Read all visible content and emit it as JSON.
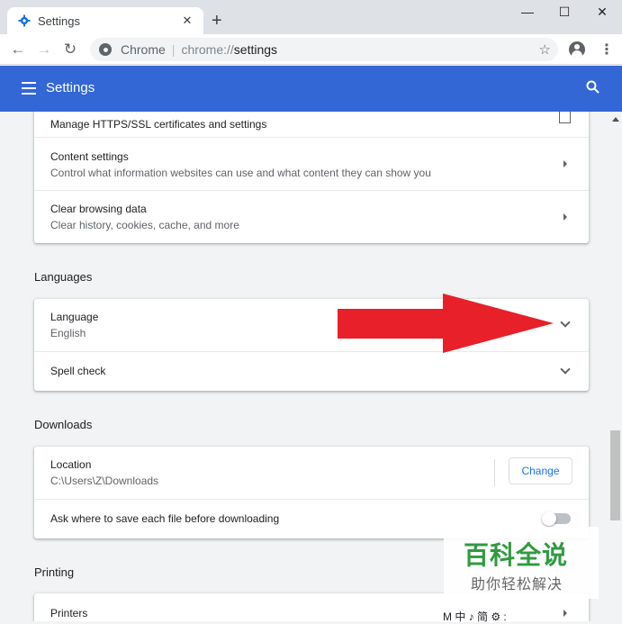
{
  "tab": {
    "title": "Settings"
  },
  "window": {
    "minimize": "—",
    "maximize": "☐",
    "close": "✕"
  },
  "toolbar": {
    "site_chip": "Chrome",
    "url_scheme": "chrome://",
    "url_path": "settings"
  },
  "header": {
    "title": "Settings"
  },
  "sections": {
    "privacy": {
      "rows": [
        {
          "title": "Manage HTTPS/SSL certificates and settings"
        },
        {
          "title": "Content settings",
          "subtitle": "Control what information websites can use and what content they can show you"
        },
        {
          "title": "Clear browsing data",
          "subtitle": "Clear history, cookies, cache, and more"
        }
      ]
    },
    "languages": {
      "title": "Languages",
      "rows": [
        {
          "title": "Language",
          "subtitle": "English"
        },
        {
          "title": "Spell check"
        }
      ]
    },
    "downloads": {
      "title": "Downloads",
      "location_label": "Location",
      "location_value": "C:\\Users\\Z\\Downloads",
      "change_button": "Change",
      "ask_label": "Ask where to save each file before downloading",
      "ask_enabled": false
    },
    "printing": {
      "title": "Printing",
      "rows": [
        {
          "title": "Printers"
        }
      ]
    }
  },
  "watermark": {
    "line1": "百科全说",
    "line2": "助你轻松解决"
  },
  "ime_bar": "M 中 ♪ 简 ⚙ :",
  "colors": {
    "header": "#3367d6",
    "accent": "#1a73e8",
    "annotation_arrow": "#e8202a",
    "watermark": "#2e9b3f"
  },
  "icons": [
    "settings-gear-icon",
    "close-icon",
    "plus-icon",
    "back-icon",
    "forward-icon",
    "reload-icon",
    "star-icon",
    "profile-icon",
    "menu-icon",
    "hamburger-icon",
    "search-icon",
    "chevron-right-icon",
    "chevron-down-icon",
    "open-external-icon"
  ]
}
